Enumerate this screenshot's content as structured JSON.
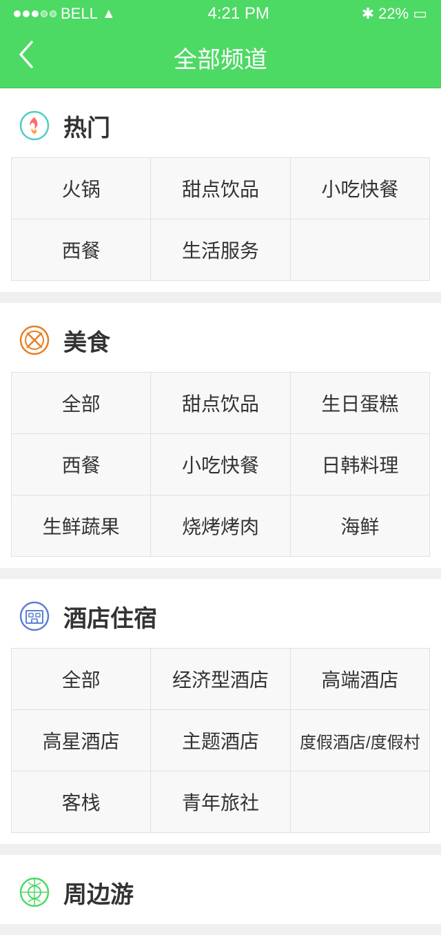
{
  "statusBar": {
    "carrier": "BELL",
    "time": "4:21 PM",
    "battery": "22%"
  },
  "navBar": {
    "backLabel": "<",
    "title": "全部频道"
  },
  "sections": [
    {
      "id": "hot",
      "iconType": "hot",
      "title": "热门",
      "items": [
        [
          "火锅",
          "甜点饮品",
          "小吃快餐"
        ],
        [
          "西餐",
          "生活服务",
          ""
        ]
      ]
    },
    {
      "id": "food",
      "iconType": "food",
      "title": "美食",
      "items": [
        [
          "全部",
          "甜点饮品",
          "生日蛋糕"
        ],
        [
          "西餐",
          "小吃快餐",
          "日韩料理"
        ],
        [
          "生鲜蔬果",
          "烧烤烤肉",
          "海鲜"
        ]
      ]
    },
    {
      "id": "hotel",
      "iconType": "hotel",
      "title": "酒店住宿",
      "items": [
        [
          "全部",
          "经济型酒店",
          "高端酒店"
        ],
        [
          "高星酒店",
          "主题酒店",
          "度假酒店/度假村"
        ],
        [
          "客栈",
          "青年旅社",
          ""
        ]
      ]
    },
    {
      "id": "travel",
      "iconType": "travel",
      "title": "周边游",
      "items": []
    }
  ]
}
